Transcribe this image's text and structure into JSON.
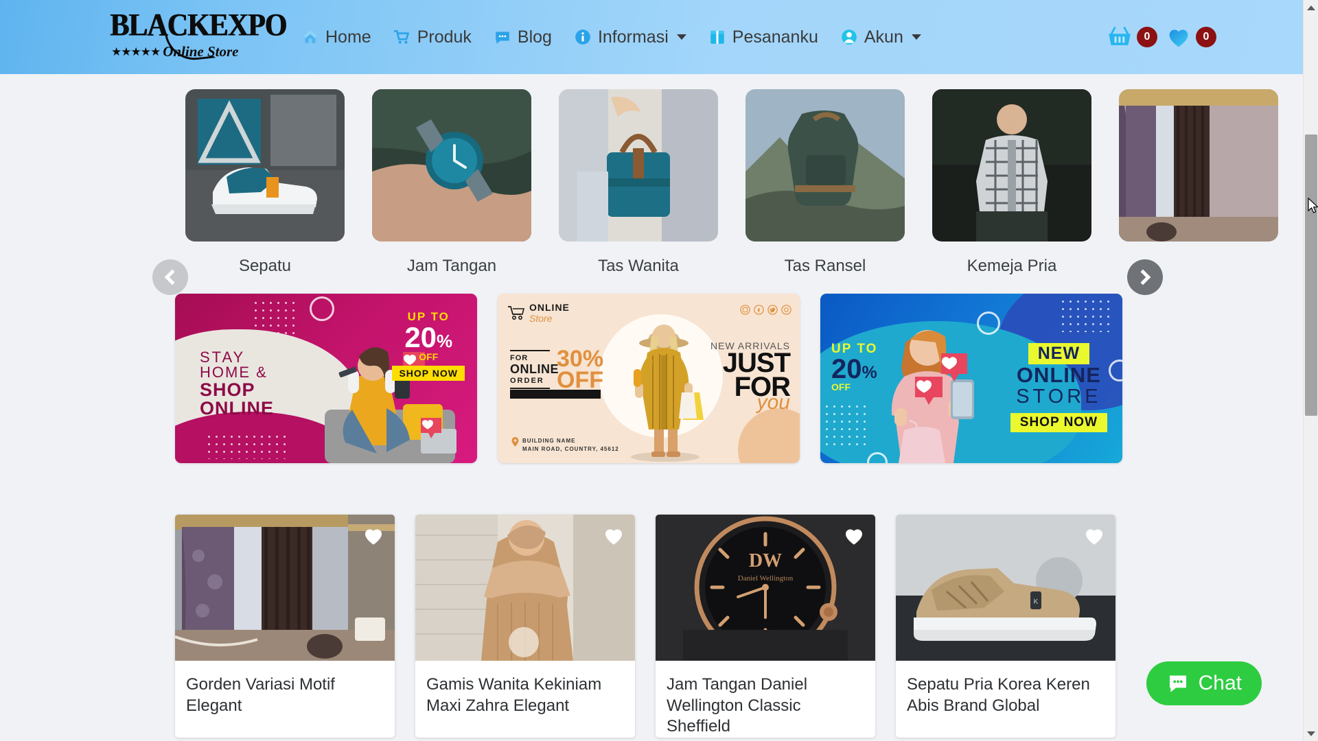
{
  "header": {
    "logo": {
      "main": "BLACKEXPO",
      "stars": "★★★★★",
      "sub": "Online Store"
    },
    "nav": [
      {
        "label": "Home",
        "icon": "house-icon",
        "dropdown": false
      },
      {
        "label": "Produk",
        "icon": "shopping-cart-icon",
        "dropdown": false
      },
      {
        "label": "Blog",
        "icon": "speech-bubble-icon",
        "dropdown": false
      },
      {
        "label": "Informasi",
        "icon": "info-circle-icon",
        "dropdown": true
      },
      {
        "label": "Pesananku",
        "icon": "package-box-icon",
        "dropdown": false
      },
      {
        "label": "Akun",
        "icon": "user-circle-icon",
        "dropdown": true
      }
    ],
    "cart": {
      "icon": "shopping-basket-icon",
      "count": "0"
    },
    "wishlist": {
      "icon": "heart-icon",
      "count": "0"
    },
    "badge_color": "#8b1113",
    "gradient_from": "#5fb4ef",
    "gradient_to": "#a8d8fb"
  },
  "categories": {
    "prev_label": "‹",
    "next_label": "›",
    "items": [
      {
        "label": "Sepatu"
      },
      {
        "label": "Jam Tangan"
      },
      {
        "label": "Tas Wanita"
      },
      {
        "label": "Tas Ransel"
      },
      {
        "label": "Kemeja Pria"
      },
      {
        "label": ""
      }
    ]
  },
  "banners": [
    {
      "id": "stay-home-shop-online",
      "line1": "STAY",
      "line2": "HOME &",
      "line3": "SHOP",
      "line4": "ONLINE",
      "up_to": "UP TO",
      "percent": "20",
      "percent_sym": "%",
      "off": "OFF",
      "cta": "SHOP NOW",
      "accent": "#d81b7f"
    },
    {
      "id": "just-for-you",
      "logo_online": "ONLINE",
      "logo_store": "Store",
      "for": "FOR",
      "online": "ONLINE",
      "order": "ORDER",
      "percent": "30%",
      "off": "OFF",
      "new_arrivals": "NEW ARRIVALS",
      "just": "JUST",
      "forr": "FOR",
      "you": "you",
      "addr1": "BUILDING NAME",
      "addr2": "MAIN ROAD, COUNTRY, 45612",
      "accent": "#e0903f"
    },
    {
      "id": "new-online-store",
      "up_to": "UP TO",
      "percent": "20",
      "percent_sym": "%",
      "off": "OFF",
      "new": "NEW",
      "online": "ONLINE",
      "store": "STORE",
      "cta": "SHOP NOW",
      "accent": "#eaf82e"
    }
  ],
  "products": [
    {
      "title": "Gorden Variasi Motif Elegant",
      "wishlist_icon": "heart-icon"
    },
    {
      "title": "Gamis Wanita Kekiniam Maxi Zahra Elegant",
      "wishlist_icon": "heart-icon"
    },
    {
      "title": "Jam Tangan Daniel Wellington Classic Sheffield",
      "wishlist_icon": "heart-icon"
    },
    {
      "title": "Sepatu Pria Korea Keren Abis Brand Global",
      "wishlist_icon": "heart-icon"
    }
  ],
  "chat": {
    "label": "Chat",
    "icon": "chat-bubble-icon",
    "color": "#2ecc41"
  }
}
